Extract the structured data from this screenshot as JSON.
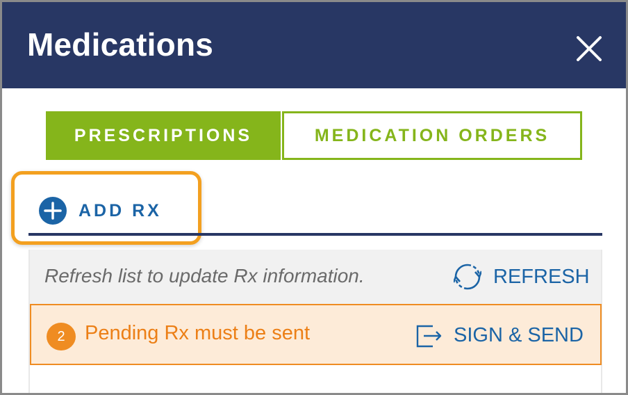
{
  "header": {
    "title": "Medications",
    "close_icon": "close-icon",
    "background_color": "#283764"
  },
  "tabs": [
    {
      "label": "PRESCRIPTIONS",
      "active": true
    },
    {
      "label": "MEDICATION ORDERS",
      "active": false
    }
  ],
  "toolbar": {
    "add_rx_label": "ADD RX",
    "add_rx_icon": "plus-circle-icon",
    "highlight_color": "#f3a020"
  },
  "refresh_row": {
    "hint": "Refresh list to update Rx information.",
    "refresh_label": "REFRESH",
    "refresh_icon": "refresh-icon"
  },
  "pending_row": {
    "count": "2",
    "message": "Pending Rx must be sent",
    "sign_send_label": "SIGN & SEND",
    "sign_send_icon": "sign-send-icon",
    "accent_color": "#ef8c22"
  },
  "colors": {
    "accent_green": "#85b51b",
    "link_blue": "#1b64a6"
  }
}
